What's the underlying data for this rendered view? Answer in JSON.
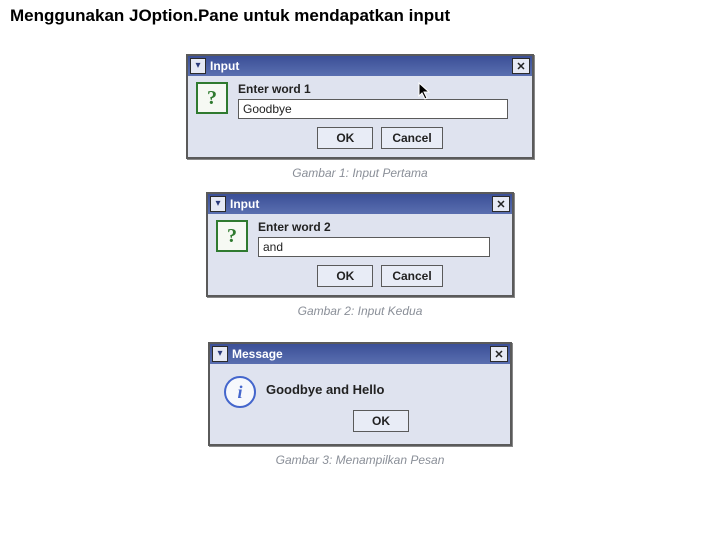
{
  "page_title": "Menggunakan JOption.Pane untuk mendapatkan input",
  "dialogs": {
    "d1": {
      "title": "Input",
      "prompt": "Enter word 1",
      "value": "Goodbye",
      "ok": "OK",
      "cancel": "Cancel",
      "icon": "?"
    },
    "d2": {
      "title": "Input",
      "prompt": "Enter word 2",
      "value": "and",
      "ok": "OK",
      "cancel": "Cancel",
      "icon": "?"
    },
    "d3": {
      "title": "Message",
      "message": "Goodbye and Hello",
      "ok": "OK",
      "icon": "i"
    }
  },
  "captions": {
    "c1": "Gambar 1: Input Pertama",
    "c2": "Gambar 2: Input Kedua",
    "c3": "Gambar 3: Menampilkan Pesan"
  },
  "close_glyph": "✕",
  "chevron_glyph": "▾"
}
